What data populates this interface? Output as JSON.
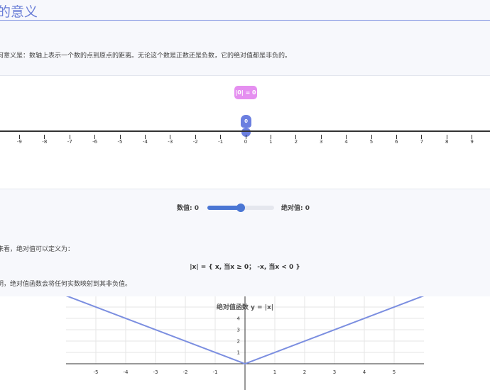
{
  "page": {
    "title": "的意义",
    "intro": "何意义是：数轴上表示一个数的点到原点的距离。无论这个数是正数还是负数，它的绝对值都是非负的。"
  },
  "number_line": {
    "abs_label": "|0| = 0",
    "marker_value": "0",
    "ticks": [
      "-9",
      "-8",
      "-7",
      "-6",
      "-5",
      "-4",
      "-3",
      "-2",
      "-1",
      "0",
      "1",
      "2",
      "3",
      "4",
      "5",
      "6",
      "7",
      "8",
      "9"
    ]
  },
  "controls": {
    "value_label": "数值: 0",
    "abs_label": "绝对值: 0",
    "slider_fraction": 0.5
  },
  "definition": {
    "text": "来看，绝对值可以定义为：",
    "formula": "|x| = { x, 当x ≥ 0；  -x, 当x < 0 }",
    "note": "明，绝对值函数会将任何实数映射到其非负值。"
  },
  "colors": {
    "accent": "#6b7fd7",
    "marker": "#6b7fe0",
    "label_pink": "#e58ff0",
    "slider": "#4a76d4"
  },
  "chart_data": {
    "type": "line",
    "title": "绝对值函数 y = |x|",
    "x_ticks": [
      "-5",
      "-4",
      "-3",
      "-2",
      "-1",
      "1",
      "2",
      "3",
      "4",
      "5"
    ],
    "y_ticks": [
      "1",
      "2",
      "3",
      "4"
    ],
    "xlim": [
      -6,
      6
    ],
    "ylim": [
      0,
      5.9
    ],
    "grid": true,
    "series": [
      {
        "x": [
          -6,
          0,
          6
        ],
        "y": [
          6,
          0,
          6
        ]
      }
    ]
  }
}
